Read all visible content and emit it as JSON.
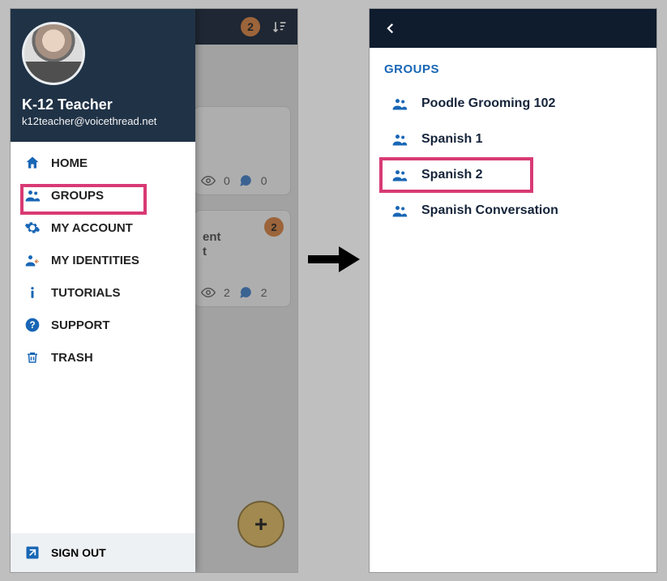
{
  "left": {
    "header": {
      "badge": "2"
    },
    "cards": [
      {
        "views": "0",
        "comments": "0"
      },
      {
        "snippet_line1": "ent",
        "snippet_line2": "t",
        "badge": "2",
        "views": "2",
        "comments": "2"
      }
    ],
    "drawer": {
      "user_name": "K-12 Teacher",
      "user_email": "k12teacher@voicethread.net",
      "items": {
        "home": "HOME",
        "groups": "GROUPS",
        "my_account": "MY ACCOUNT",
        "my_identities": "MY IDENTITIES",
        "tutorials": "TUTORIALS",
        "support": "SUPPORT",
        "trash": "TRASH"
      },
      "sign_out": "SIGN OUT"
    }
  },
  "right": {
    "title": "GROUPS",
    "groups": {
      "g0": "Poodle Grooming 102",
      "g1": "Spanish 1",
      "g2": "Spanish 2",
      "g3": "Spanish Conversation"
    }
  }
}
